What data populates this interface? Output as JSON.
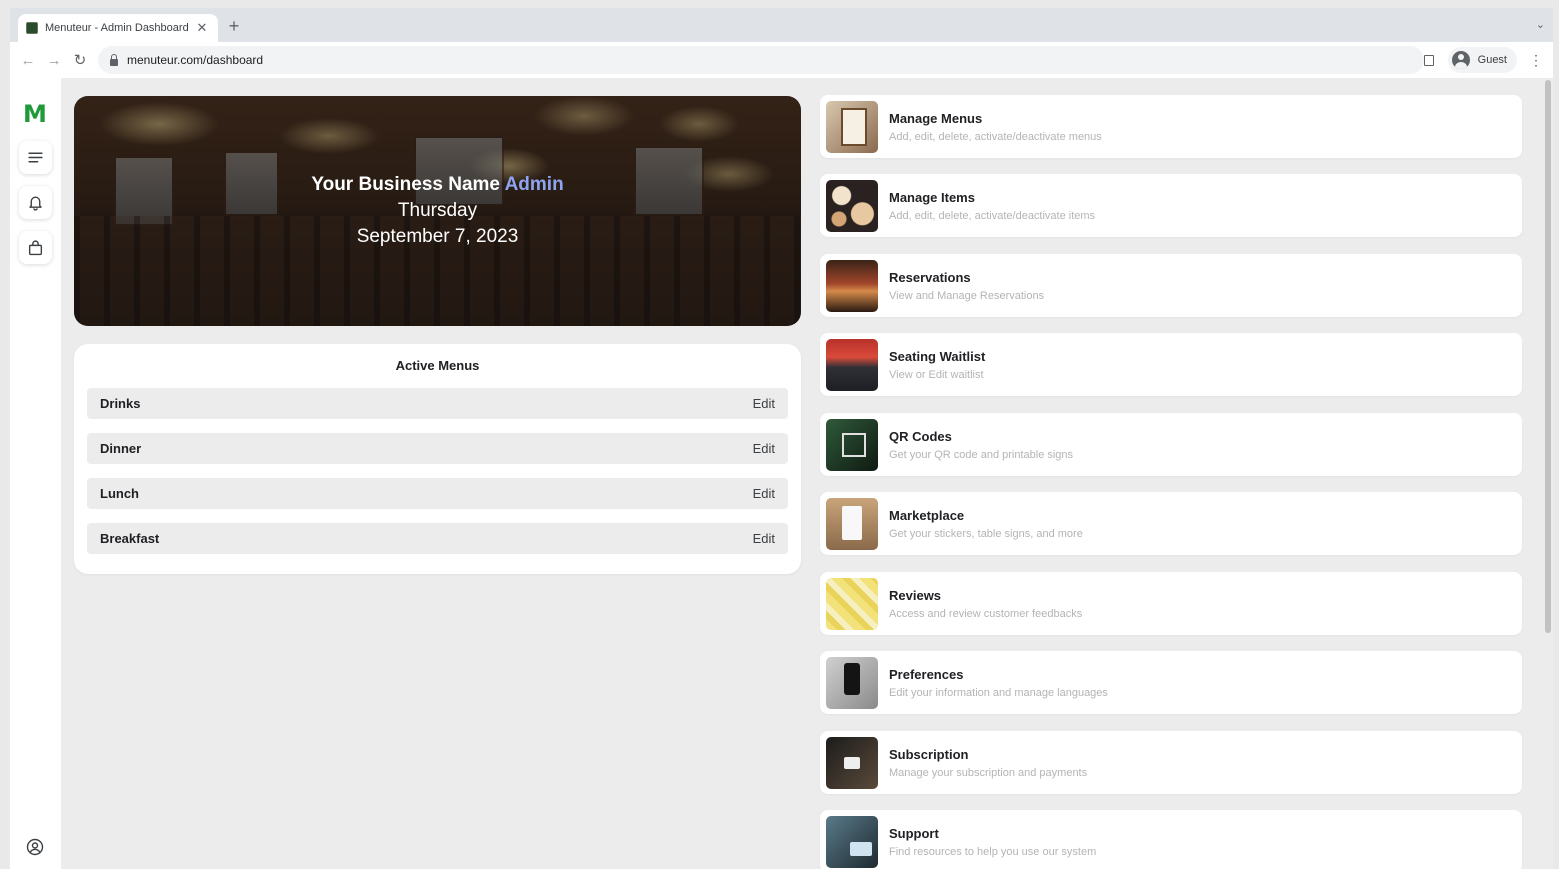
{
  "browser": {
    "tab_title": "Menuteur - Admin Dashboard",
    "url": "menuteur.com/dashboard",
    "profile_label": "Guest"
  },
  "sidebar": {
    "logo": "M"
  },
  "hero": {
    "business_name": "Your Business Name",
    "role": "Admin",
    "day": "Thursday",
    "date": "September 7, 2023"
  },
  "active_menus": {
    "title": "Active Menus",
    "items": [
      {
        "name": "Drinks",
        "action": "Edit"
      },
      {
        "name": "Dinner",
        "action": "Edit"
      },
      {
        "name": "Lunch",
        "action": "Edit"
      },
      {
        "name": "Breakfast",
        "action": "Edit"
      }
    ]
  },
  "nav_cards": [
    {
      "title": "Manage Menus",
      "desc": "Add, edit, delete, activate/deactivate menus"
    },
    {
      "title": "Manage Items",
      "desc": "Add, edit, delete, activate/deactivate items"
    },
    {
      "title": "Reservations",
      "desc": "View and Manage Reservations"
    },
    {
      "title": "Seating Waitlist",
      "desc": "View or Edit waitlist"
    },
    {
      "title": "QR Codes",
      "desc": "Get your QR code and printable signs"
    },
    {
      "title": "Marketplace",
      "desc": "Get your stickers, table signs, and more"
    },
    {
      "title": "Reviews",
      "desc": "Access and review customer feedbacks"
    },
    {
      "title": "Preferences",
      "desc": "Edit your information and manage languages"
    },
    {
      "title": "Subscription",
      "desc": "Manage your subscription and payments"
    },
    {
      "title": "Support",
      "desc": "Find resources to help you use our system"
    }
  ],
  "colors": {
    "brand_green": "#1f9a3a",
    "admin_accent": "#8fa4f0",
    "description_gray": "#b4b4b4"
  }
}
